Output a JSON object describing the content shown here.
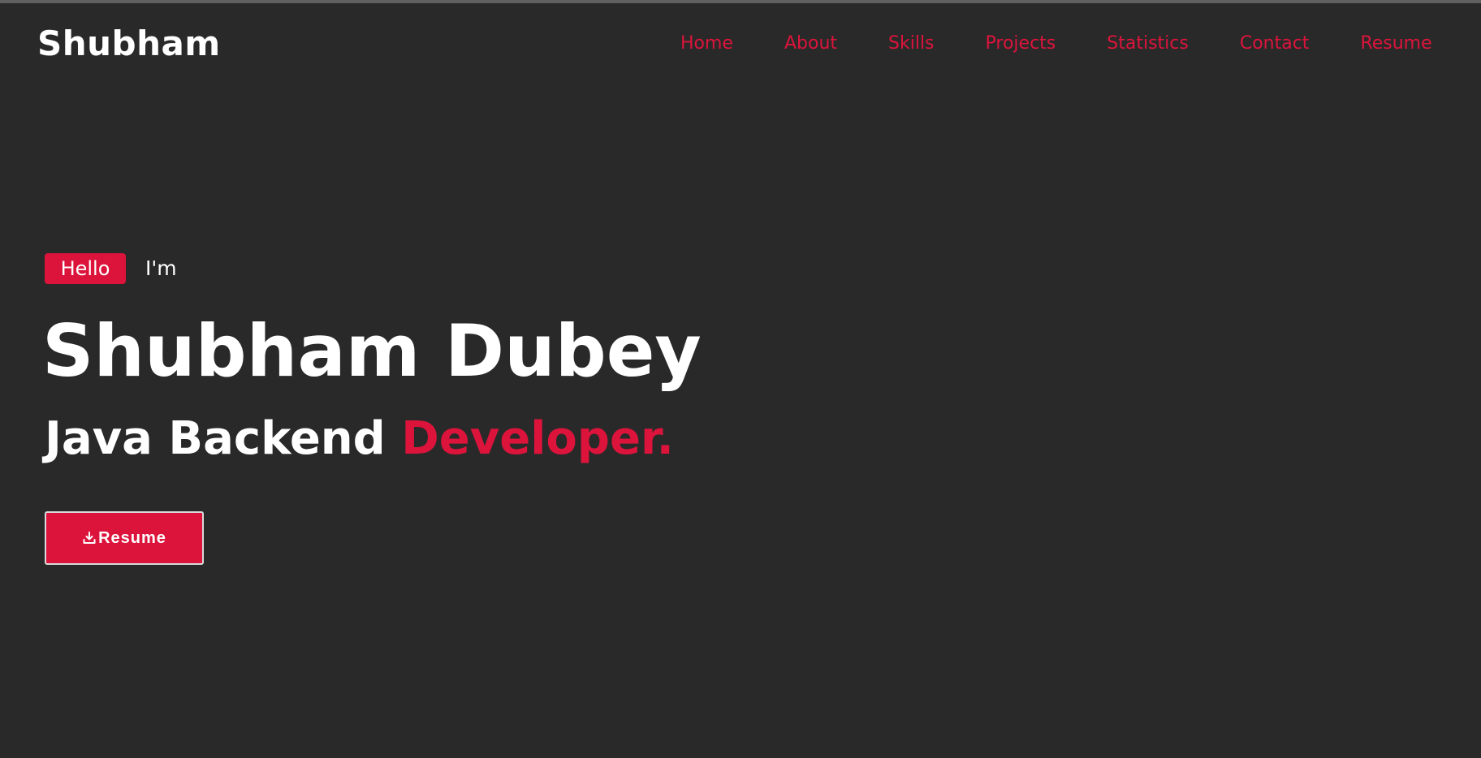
{
  "header": {
    "logo": "Shubham",
    "nav": [
      {
        "label": "Home"
      },
      {
        "label": "About"
      },
      {
        "label": "Skills"
      },
      {
        "label": "Projects"
      },
      {
        "label": "Statistics"
      },
      {
        "label": "Contact"
      },
      {
        "label": "Resume"
      }
    ]
  },
  "hero": {
    "badge": "Hello",
    "intro": "I'm",
    "name": "Shubham Dubey",
    "role_prefix": "Java Backend",
    "role_accent": "Developer.",
    "cta": {
      "label": "Resume",
      "icon": "download-icon"
    }
  },
  "colors": {
    "background": "#292929",
    "accent": "#dc143c",
    "text": "#ffffff"
  }
}
